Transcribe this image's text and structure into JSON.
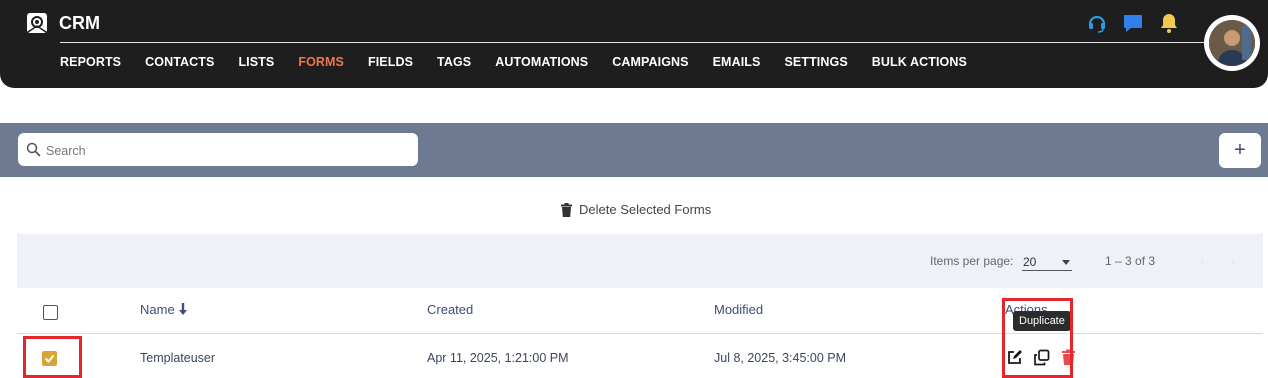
{
  "app": {
    "name": "CRM",
    "logo_icon": "crm-logo-icon"
  },
  "topbar": {
    "nav": [
      {
        "label": "REPORTS",
        "active": false
      },
      {
        "label": "CONTACTS",
        "active": false
      },
      {
        "label": "LISTS",
        "active": false
      },
      {
        "label": "FORMS",
        "active": true
      },
      {
        "label": "FIELDS",
        "active": false
      },
      {
        "label": "TAGS",
        "active": false
      },
      {
        "label": "AUTOMATIONS",
        "active": false
      },
      {
        "label": "CAMPAIGNS",
        "active": false
      },
      {
        "label": "EMAILS",
        "active": false
      },
      {
        "label": "SETTINGS",
        "active": false
      },
      {
        "label": "BULK ACTIONS",
        "active": false
      }
    ],
    "icons": [
      "support-headset-icon",
      "chat-icon",
      "notification-bell-icon"
    ],
    "icon_colors": {
      "support": "#2d9cdb",
      "chat": "#2f80ed",
      "bell": "#f2c94c"
    },
    "active_color": "#f1774a"
  },
  "toolbar": {
    "search_placeholder": "Search",
    "add_label": "+"
  },
  "bulk": {
    "delete_selected_label": "Delete Selected Forms"
  },
  "pagination": {
    "items_per_page_label": "Items per page:",
    "items_per_page": "20",
    "range": "1 – 3 of 3"
  },
  "table": {
    "headers": {
      "name": "Name",
      "created": "Created",
      "modified": "Modified",
      "actions": "Actions"
    },
    "rows": [
      {
        "selected": true,
        "name": "Templateuser",
        "created": "Apr 11, 2025, 1:21:00 PM",
        "modified": "Jul 8, 2025, 3:45:00 PM"
      }
    ]
  },
  "tooltip": {
    "text": "Duplicate"
  },
  "colors": {
    "accent": "#f1774a",
    "checkbox_checked": "#d9a436",
    "highlight": "#e3272c",
    "toolbar_bg": "#6d7a91"
  }
}
